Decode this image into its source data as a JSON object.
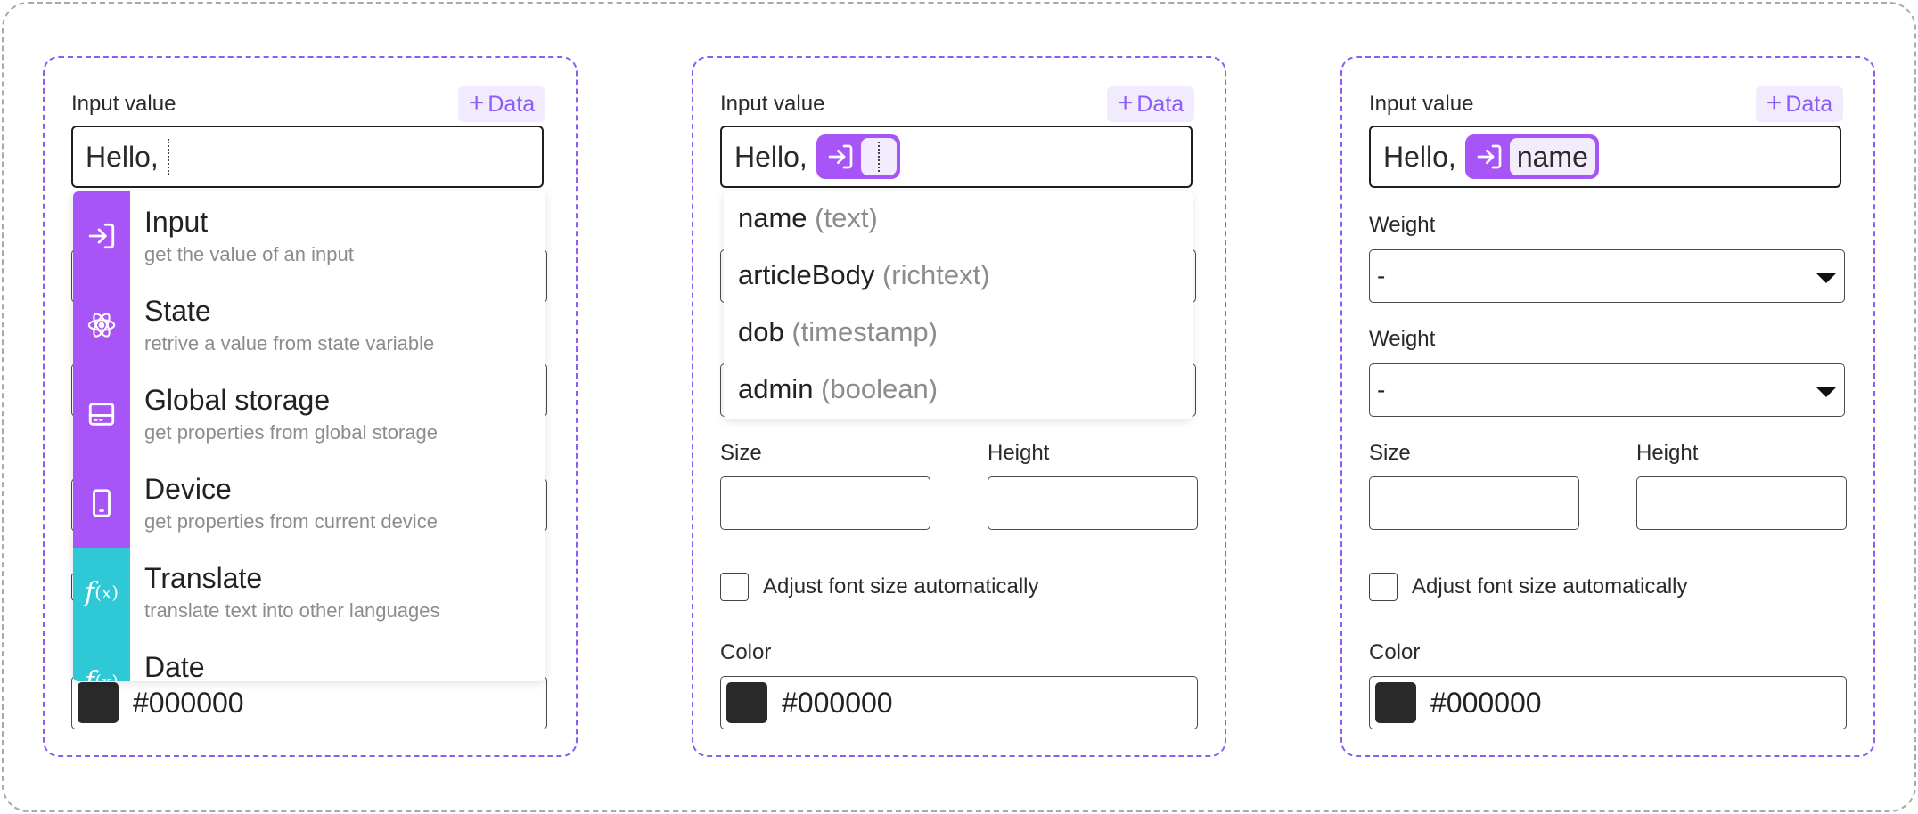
{
  "colors": {
    "accent": "#8b5cf6",
    "chip": "#a855f7",
    "menu_purple": "#a855f7",
    "menu_teal": "#2ec8d6",
    "swatch": "#2a2a2a"
  },
  "data_button": {
    "icon": "plus-icon",
    "label": "Data"
  },
  "panel1": {
    "input_label": "Input value",
    "input_text": "Hello,",
    "color_value": "#000000",
    "menu": [
      {
        "title": "Input",
        "sub": "get the value of an input",
        "icon": "input-arrow-icon",
        "color": "#a855f7"
      },
      {
        "title": "State",
        "sub": "retrive a value from state variable",
        "icon": "atom-icon",
        "color": "#a855f7"
      },
      {
        "title": "Global storage",
        "sub": "get properties from global storage",
        "icon": "storage-icon",
        "color": "#a855f7"
      },
      {
        "title": "Device",
        "sub": "get properties from current device",
        "icon": "phone-icon",
        "color": "#a855f7"
      },
      {
        "title": "Translate",
        "sub": "translate text into other languages",
        "icon": "function-icon",
        "color": "#2ec8d6"
      },
      {
        "title": "Date",
        "sub": "",
        "icon": "function-icon",
        "color": "#2ec8d6"
      }
    ]
  },
  "panel2": {
    "input_label": "Input value",
    "input_text": "Hello,",
    "menu": [
      {
        "name": "name",
        "type": "(text)"
      },
      {
        "name": "articleBody",
        "type": "(richtext)"
      },
      {
        "name": "dob",
        "type": "(timestamp)"
      },
      {
        "name": "admin",
        "type": "(boolean)"
      }
    ],
    "size_label": "Size",
    "height_label": "Height",
    "checkbox_label": "Adjust font size automatically",
    "color_label": "Color",
    "color_value": "#000000"
  },
  "panel3": {
    "input_label": "Input value",
    "input_text": "Hello,",
    "chip_value": "name",
    "weight_label_1": "Weight",
    "weight_value_1": "-",
    "weight_label_2": "Weight",
    "weight_value_2": "-",
    "size_label": "Size",
    "height_label": "Height",
    "checkbox_label": "Adjust font size automatically",
    "color_label": "Color",
    "color_value": "#000000"
  }
}
